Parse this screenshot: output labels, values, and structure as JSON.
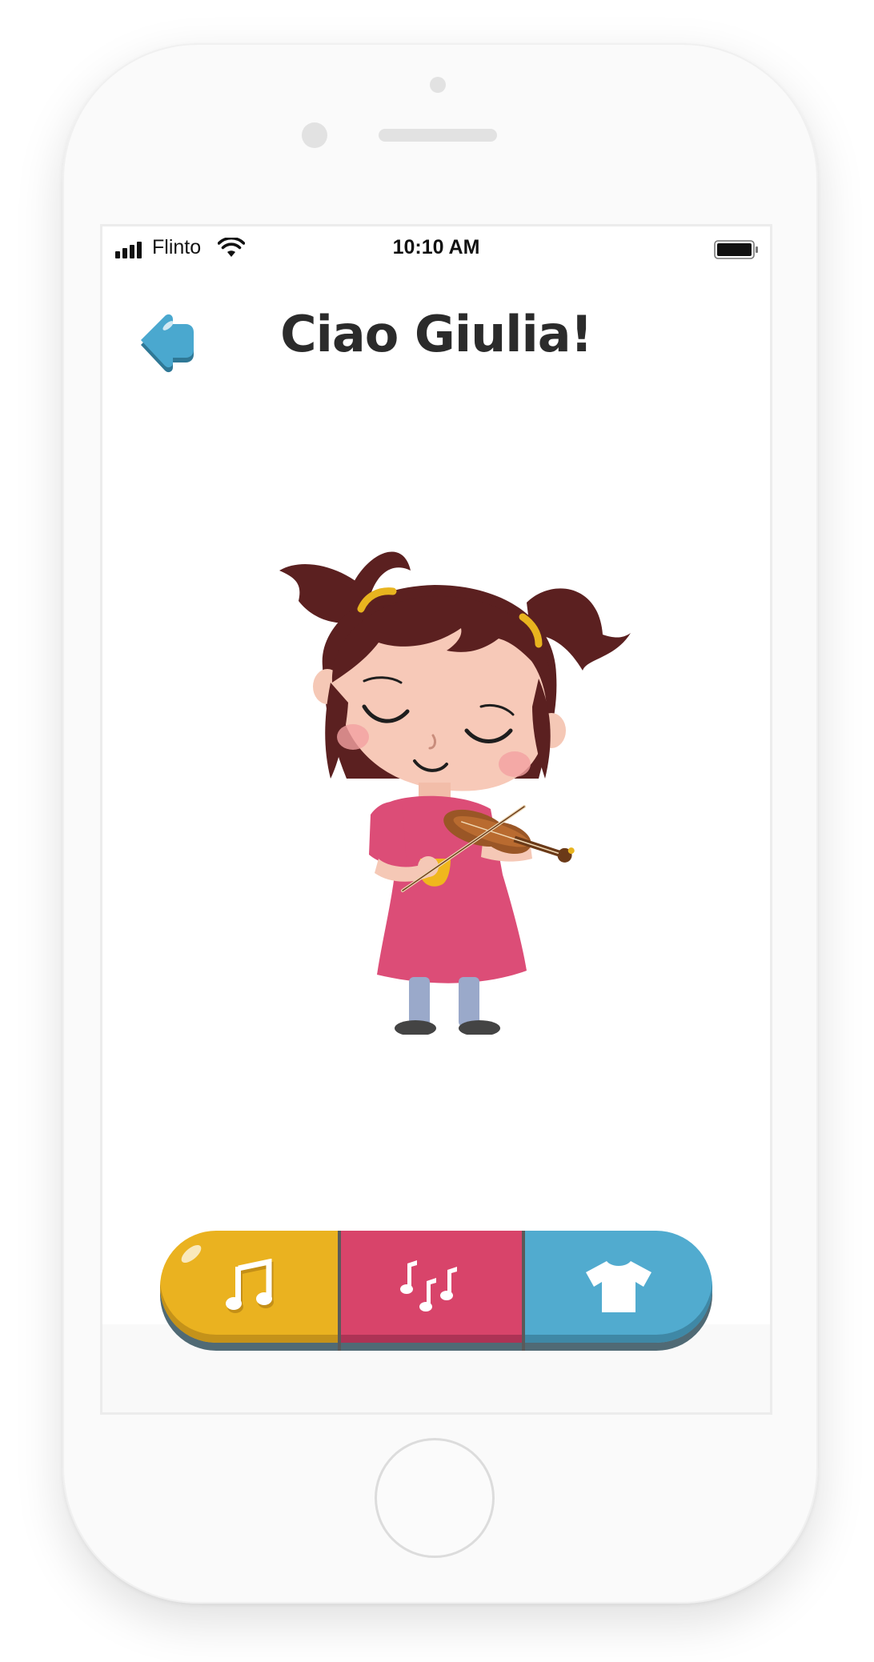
{
  "status_bar": {
    "carrier": "Flinto",
    "time": "10:10 AM"
  },
  "header": {
    "title": "Ciao Giulia!",
    "back_icon": "back-arrow-icon"
  },
  "illustration": {
    "subject": "girl-playing-violin"
  },
  "tabbar": {
    "tabs": [
      {
        "icon": "music-note-icon",
        "color": "#eab220"
      },
      {
        "icon": "music-notes-icon",
        "color": "#d8446a"
      },
      {
        "icon": "t-shirt-icon",
        "color": "#51abcf"
      }
    ]
  },
  "colors": {
    "title_text": "#2b2b2b",
    "back_button": "#4aa8cf"
  }
}
